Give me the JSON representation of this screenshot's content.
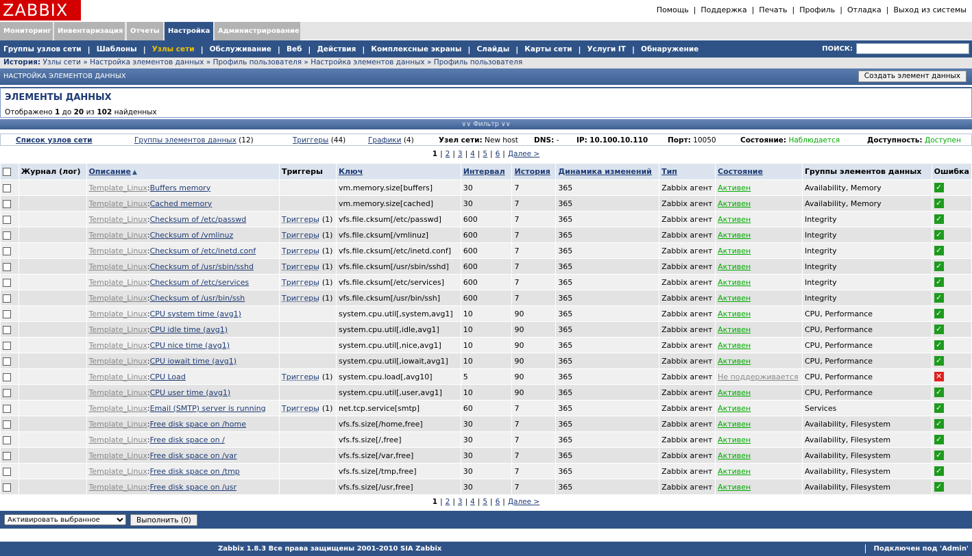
{
  "logo": "ZABBIX",
  "top_links": [
    "Помощь",
    "Поддержка",
    "Печать",
    "Профиль",
    "Отладка",
    "Выход из системы"
  ],
  "menu1": [
    {
      "label": "Мониторинг",
      "active": false
    },
    {
      "label": "Инвентаризация",
      "active": false
    },
    {
      "label": "Отчеты",
      "active": false
    },
    {
      "label": "Настройка",
      "active": true
    },
    {
      "label": "Администрирование",
      "active": false
    }
  ],
  "menu2": [
    {
      "label": "Группы узлов сети",
      "active": false
    },
    {
      "label": "Шаблоны",
      "active": false
    },
    {
      "label": "Узлы сети",
      "active": true
    },
    {
      "label": "Обслуживание",
      "active": false
    },
    {
      "label": "Веб",
      "active": false
    },
    {
      "label": "Действия",
      "active": false
    },
    {
      "label": "Комплексные экраны",
      "active": false
    },
    {
      "label": "Слайды",
      "active": false
    },
    {
      "label": "Карты сети",
      "active": false
    },
    {
      "label": "Услуги IT",
      "active": false
    },
    {
      "label": "Обнаружение",
      "active": false
    }
  ],
  "search_label": "ПОИСК:",
  "history": {
    "label": "История:",
    "items": [
      "Узлы сети",
      "Настройка элементов данных",
      "Профиль пользователя",
      "Настройка элементов данных",
      "Профиль пользователя"
    ]
  },
  "section_title": "НАСТРОЙКА ЭЛЕМЕНТОВ ДАННЫХ",
  "create_button": "Создать элемент данных",
  "page_title": "ЭЛЕМЕНТЫ ДАННЫХ",
  "summary": {
    "prefix": "Отображено",
    "from": "1",
    "to_word": "до",
    "to": "20",
    "of_word": "из",
    "total": "102",
    "suffix": "найденных"
  },
  "filter_label": "Фильтр",
  "host_bar": {
    "host_list": "Список узлов сети",
    "item_groups": "Группы элементов данных",
    "item_groups_count": "(12)",
    "triggers": "Триггеры",
    "triggers_count": "(44)",
    "graphs": "Графики",
    "graphs_count": "(4)",
    "host_label": "Узел сети:",
    "host_value": "New host",
    "dns_label": "DNS:",
    "dns_value": "-",
    "ip_label": "IP:",
    "ip_value": "10.100.10.110",
    "port_label": "Порт:",
    "port_value": "10050",
    "state_label": "Состояние:",
    "state_value": "Наблюдается",
    "avail_label": "Доступность:",
    "avail_value": "Доступен"
  },
  "pager": {
    "current": "1",
    "pages": [
      "2",
      "3",
      "4",
      "5",
      "6"
    ],
    "next": "Далее >"
  },
  "columns": [
    "Журнал (лог)",
    "Описание",
    "Триггеры",
    "Ключ",
    "Интервал",
    "История",
    "Динамика изменений",
    "Тип",
    "Состояние",
    "Группы элементов данных",
    "Ошибка"
  ],
  "rows": [
    {
      "tpl": "Template_Linux",
      "name": "Buffers memory",
      "trig": "",
      "trig_count": "",
      "key": "vm.memory.size[buffers]",
      "interval": "30",
      "history": "7",
      "trends": "365",
      "type": "Zabbix агент",
      "status": "Активен",
      "groups": "Availability, Memory",
      "error": "ok"
    },
    {
      "tpl": "Template_Linux",
      "name": "Cached memory",
      "trig": "",
      "trig_count": "",
      "key": "vm.memory.size[cached]",
      "interval": "30",
      "history": "7",
      "trends": "365",
      "type": "Zabbix агент",
      "status": "Активен",
      "groups": "Availability, Memory",
      "error": "ok"
    },
    {
      "tpl": "Template_Linux",
      "name": "Checksum of /etc/passwd",
      "trig": "Триггеры",
      "trig_count": "(1)",
      "key": "vfs.file.cksum[/etc/passwd]",
      "interval": "600",
      "history": "7",
      "trends": "365",
      "type": "Zabbix агент",
      "status": "Активен",
      "groups": "Integrity",
      "error": "ok"
    },
    {
      "tpl": "Template_Linux",
      "name": "Checksum of /vmlinuz",
      "trig": "Триггеры",
      "trig_count": "(1)",
      "key": "vfs.file.cksum[/vmlinuz]",
      "interval": "600",
      "history": "7",
      "trends": "365",
      "type": "Zabbix агент",
      "status": "Активен",
      "groups": "Integrity",
      "error": "ok"
    },
    {
      "tpl": "Template_Linux",
      "name": "Checksum of /etc/inetd.conf",
      "trig": "Триггеры",
      "trig_count": "(1)",
      "key": "vfs.file.cksum[/etc/inetd.conf]",
      "interval": "600",
      "history": "7",
      "trends": "365",
      "type": "Zabbix агент",
      "status": "Активен",
      "groups": "Integrity",
      "error": "ok"
    },
    {
      "tpl": "Template_Linux",
      "name": "Checksum of /usr/sbin/sshd",
      "trig": "Триггеры",
      "trig_count": "(1)",
      "key": "vfs.file.cksum[/usr/sbin/sshd]",
      "interval": "600",
      "history": "7",
      "trends": "365",
      "type": "Zabbix агент",
      "status": "Активен",
      "groups": "Integrity",
      "error": "ok"
    },
    {
      "tpl": "Template_Linux",
      "name": "Checksum of /etc/services",
      "trig": "Триггеры",
      "trig_count": "(1)",
      "key": "vfs.file.cksum[/etc/services]",
      "interval": "600",
      "history": "7",
      "trends": "365",
      "type": "Zabbix агент",
      "status": "Активен",
      "groups": "Integrity",
      "error": "ok"
    },
    {
      "tpl": "Template_Linux",
      "name": "Checksum of /usr/bin/ssh",
      "trig": "Триггеры",
      "trig_count": "(1)",
      "key": "vfs.file.cksum[/usr/bin/ssh]",
      "interval": "600",
      "history": "7",
      "trends": "365",
      "type": "Zabbix агент",
      "status": "Активен",
      "groups": "Integrity",
      "error": "ok"
    },
    {
      "tpl": "Template_Linux",
      "name": "CPU system time (avg1)",
      "trig": "",
      "trig_count": "",
      "key": "system.cpu.util[,system,avg1]",
      "interval": "10",
      "history": "90",
      "trends": "365",
      "type": "Zabbix агент",
      "status": "Активен",
      "groups": "CPU, Performance",
      "error": "ok"
    },
    {
      "tpl": "Template_Linux",
      "name": "CPU idle time (avg1)",
      "trig": "",
      "trig_count": "",
      "key": "system.cpu.util[,idle,avg1]",
      "interval": "10",
      "history": "90",
      "trends": "365",
      "type": "Zabbix агент",
      "status": "Активен",
      "groups": "CPU, Performance",
      "error": "ok"
    },
    {
      "tpl": "Template_Linux",
      "name": "CPU nice time (avg1)",
      "trig": "",
      "trig_count": "",
      "key": "system.cpu.util[,nice,avg1]",
      "interval": "10",
      "history": "90",
      "trends": "365",
      "type": "Zabbix агент",
      "status": "Активен",
      "groups": "CPU, Performance",
      "error": "ok"
    },
    {
      "tpl": "Template_Linux",
      "name": "CPU iowait time (avg1)",
      "trig": "",
      "trig_count": "",
      "key": "system.cpu.util[,iowait,avg1]",
      "interval": "10",
      "history": "90",
      "trends": "365",
      "type": "Zabbix агент",
      "status": "Активен",
      "groups": "CPU, Performance",
      "error": "ok"
    },
    {
      "tpl": "Template_Linux",
      "name": "CPU Load",
      "trig": "Триггеры",
      "trig_count": "(1)",
      "key": "system.cpu.load[,avg10]",
      "interval": "5",
      "history": "90",
      "trends": "365",
      "type": "Zabbix агент",
      "status": "Не поддерживается",
      "groups": "CPU, Performance",
      "error": "err"
    },
    {
      "tpl": "Template_Linux",
      "name": "CPU user time (avg1)",
      "trig": "",
      "trig_count": "",
      "key": "system.cpu.util[,user,avg1]",
      "interval": "10",
      "history": "90",
      "trends": "365",
      "type": "Zabbix агент",
      "status": "Активен",
      "groups": "CPU, Performance",
      "error": "ok"
    },
    {
      "tpl": "Template_Linux",
      "name": "Email (SMTP) server is running",
      "trig": "Триггеры",
      "trig_count": "(1)",
      "key": "net.tcp.service[smtp]",
      "interval": "60",
      "history": "7",
      "trends": "365",
      "type": "Zabbix агент",
      "status": "Активен",
      "groups": "Services",
      "error": "ok"
    },
    {
      "tpl": "Template_Linux",
      "name": "Free disk space on /home",
      "trig": "",
      "trig_count": "",
      "key": "vfs.fs.size[/home,free]",
      "interval": "30",
      "history": "7",
      "trends": "365",
      "type": "Zabbix агент",
      "status": "Активен",
      "groups": "Availability, Filesystem",
      "error": "ok"
    },
    {
      "tpl": "Template_Linux",
      "name": "Free disk space on /",
      "trig": "",
      "trig_count": "",
      "key": "vfs.fs.size[/,free]",
      "interval": "30",
      "history": "7",
      "trends": "365",
      "type": "Zabbix агент",
      "status": "Активен",
      "groups": "Availability, Filesystem",
      "error": "ok"
    },
    {
      "tpl": "Template_Linux",
      "name": "Free disk space on /var",
      "trig": "",
      "trig_count": "",
      "key": "vfs.fs.size[/var,free]",
      "interval": "30",
      "history": "7",
      "trends": "365",
      "type": "Zabbix агент",
      "status": "Активен",
      "groups": "Availability, Filesystem",
      "error": "ok"
    },
    {
      "tpl": "Template_Linux",
      "name": "Free disk space on /tmp",
      "trig": "",
      "trig_count": "",
      "key": "vfs.fs.size[/tmp,free]",
      "interval": "30",
      "history": "7",
      "trends": "365",
      "type": "Zabbix агент",
      "status": "Активен",
      "groups": "Availability, Filesystem",
      "error": "ok"
    },
    {
      "tpl": "Template_Linux",
      "name": "Free disk space on /usr",
      "trig": "",
      "trig_count": "",
      "key": "vfs.fs.size[/usr,free]",
      "interval": "30",
      "history": "7",
      "trends": "365",
      "type": "Zabbix агент",
      "status": "Активен",
      "groups": "Availability, Filesystem",
      "error": "ok"
    }
  ],
  "action_select": "Активировать выбранное",
  "action_button": "Выполнить (0)",
  "footer": {
    "text": "Zabbix 1.8.3  Все права защищены 2001-2010 SIA Zabbix",
    "connected": "Подключен под 'Admin'"
  },
  "colors": {
    "nav": "#2f5387",
    "active_tab": "#2f5387",
    "logo": "#d40000",
    "ok_green": "#00aa00",
    "active_menu": "#f0c000"
  }
}
